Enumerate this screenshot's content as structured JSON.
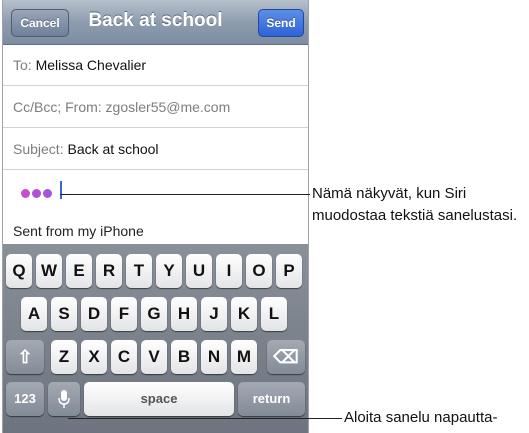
{
  "navbar": {
    "cancel_label": "Cancel",
    "title": "Back at school",
    "send_label": "Send"
  },
  "fields": {
    "to_label": "To:",
    "to_value": "Melissa Chevalier",
    "cc_label": "Cc/Bcc; From: zgosler55@me.com",
    "subject_label": "Subject:",
    "subject_value": "Back at school"
  },
  "body": {
    "signature": "Sent from my iPhone"
  },
  "keyboard": {
    "row1": [
      "Q",
      "W",
      "E",
      "R",
      "T",
      "Y",
      "U",
      "I",
      "O",
      "P"
    ],
    "row2": [
      "A",
      "S",
      "D",
      "F",
      "G",
      "H",
      "J",
      "K",
      "L"
    ],
    "row3": [
      "Z",
      "X",
      "C",
      "V",
      "B",
      "N",
      "M"
    ],
    "shift_icon": "⇧",
    "delete_icon": "⌫",
    "numbers_label": "123",
    "mic_icon": "microphone-icon",
    "space_label": "space",
    "return_label": "return"
  },
  "dictation_dots_colors": [
    "#c64fd0",
    "#b14fd6",
    "#a655d8"
  ],
  "callouts": {
    "siri": "Nämä näkyvät, kun Siri muodostaa tekstiä sanelustasi.",
    "dictation": "Aloita sanelu napautta-"
  }
}
